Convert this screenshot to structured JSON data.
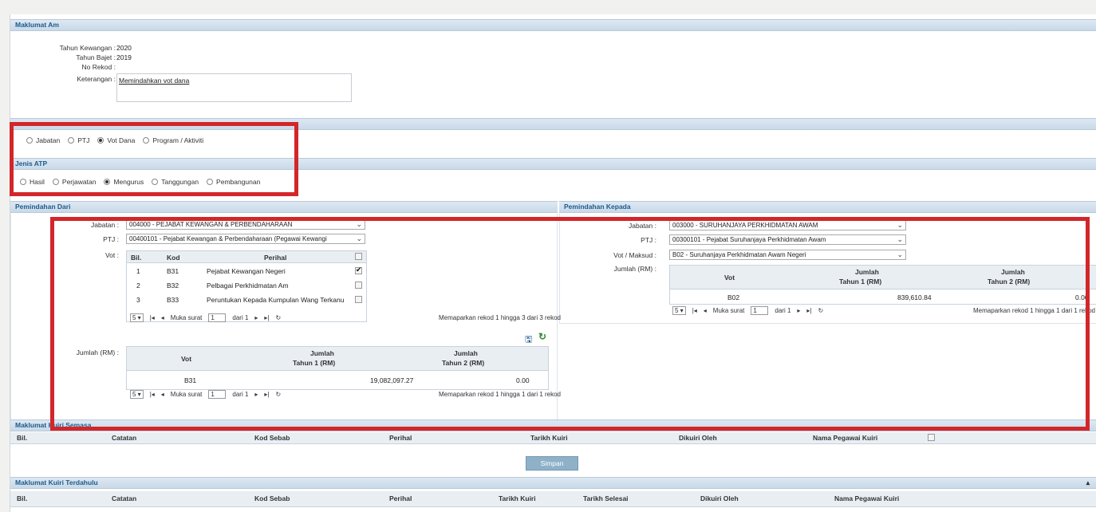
{
  "maklumat_am": {
    "title": "Maklumat Am",
    "tahun_kewangan_label": "Tahun Kewangan :",
    "tahun_kewangan": "2020",
    "tahun_bajet_label": "Tahun Bajet :",
    "tahun_bajet": "2019",
    "no_rekod_label": "No Rekod :",
    "keterangan_label": "Keterangan :",
    "keterangan": "Memindahkan vot dana"
  },
  "peringkat": {
    "options": [
      "Jabatan",
      "PTJ",
      "Vot Dana",
      "Program / Aktiviti"
    ],
    "selected": "Vot Dana"
  },
  "jenis_atp": {
    "title": "Jenis ATP",
    "options": [
      "Hasil",
      "Perjawatan",
      "Mengurus",
      "Tanggungan",
      "Pembangunan"
    ],
    "selected": "Mengurus"
  },
  "dari": {
    "title": "Pemindahan Dari",
    "jabatan_label": "Jabatan :",
    "jabatan": "004000 - PEJABAT KEWANGAN & PERBENDAHARAAN",
    "ptj_label": "PTJ :",
    "ptj": "00400101 - Pejabat Kewangan & Perbendaharaan (Pegawai Kewangi",
    "vot_label": "Vot :",
    "vot_table": {
      "headers": [
        "Bil.",
        "Kod",
        "Perihal"
      ],
      "rows": [
        {
          "bil": "1",
          "kod": "B31",
          "perihal": "Pejabat Kewangan Negeri",
          "checked": true
        },
        {
          "bil": "2",
          "kod": "B32",
          "perihal": "Pelbagai Perkhidmatan Am",
          "checked": false
        },
        {
          "bil": "3",
          "kod": "B33",
          "perihal": "Peruntukan Kepada Kumpulan Wang Terkanu",
          "checked": false
        }
      ],
      "pager": {
        "size": "5 ▾",
        "muka_surat": "Muka surat",
        "page": "1",
        "dari": "dari 1",
        "status": "Memaparkan rekod 1 hingga 3 dari 3 rekod"
      }
    },
    "jumlah_label": "Jumlah (RM) :",
    "jumlah_table": {
      "h_vot": "Vot",
      "h_t1a": "Jumlah",
      "h_t1b": "Tahun 1 (RM)",
      "h_t2a": "Jumlah",
      "h_t2b": "Tahun 2 (RM)",
      "vot": "B31",
      "t1": "19,082,097.27",
      "t2": "0.00",
      "pager": {
        "size": "5 ▾",
        "muka_surat": "Muka surat",
        "page": "1",
        "dari": "dari 1",
        "status": "Memaparkan rekod 1 hingga 1 dari 1 rekod"
      }
    }
  },
  "kepada": {
    "title": "Pemindahan Kepada",
    "jabatan_label": "Jabatan :",
    "jabatan": "003000 - SURUHANJAYA PERKHIDMATAN AWAM",
    "ptj_label": "PTJ :",
    "ptj": "00300101 - Pejabat Suruhanjaya Perkhidmatan Awam",
    "vot_label": "Vot / Maksud :",
    "vot": "B02 - Suruhanjaya Perkhidmatan Awam Negeri",
    "jumlah_label": "Jumlah (RM) :",
    "jumlah_table": {
      "h_vot": "Vot",
      "h_t1a": "Jumlah",
      "h_t1b": "Tahun 1 (RM)",
      "h_t2a": "Jumlah",
      "h_t2b": "Tahun 2 (RM)",
      "vot": "B02",
      "t1": "839,610.84",
      "t2": "0.00",
      "pager": {
        "size": "5 ▾",
        "muka_surat": "Muka surat",
        "page": "1",
        "dari": "dari 1",
        "status": "Memaparkan rekod 1 hingga 1 dari 1 rekod"
      }
    }
  },
  "kuiri_semasa": {
    "title": "Maklumat Kuiri Semasa",
    "headers": [
      "Bil.",
      "Catatan",
      "Kod Sebab",
      "Perihal",
      "Tarikh Kuiri",
      "Dikuiri Oleh",
      "Nama Pegawai Kuiri"
    ]
  },
  "simpan_label": "Simpan",
  "kuiri_terdahulu": {
    "title": "Maklumat Kuiri Terdahulu",
    "headers": [
      "Bil.",
      "Catatan",
      "Kod Sebab",
      "Perihal",
      "Tarikh Kuiri",
      "Tarikh Selesai",
      "Dikuiri Oleh",
      "Nama Pegawai Kuiri"
    ]
  },
  "colors": {
    "accent_red": "#d3262a",
    "header_blue": "#1d5a8c",
    "button": "#8fb1c8"
  }
}
